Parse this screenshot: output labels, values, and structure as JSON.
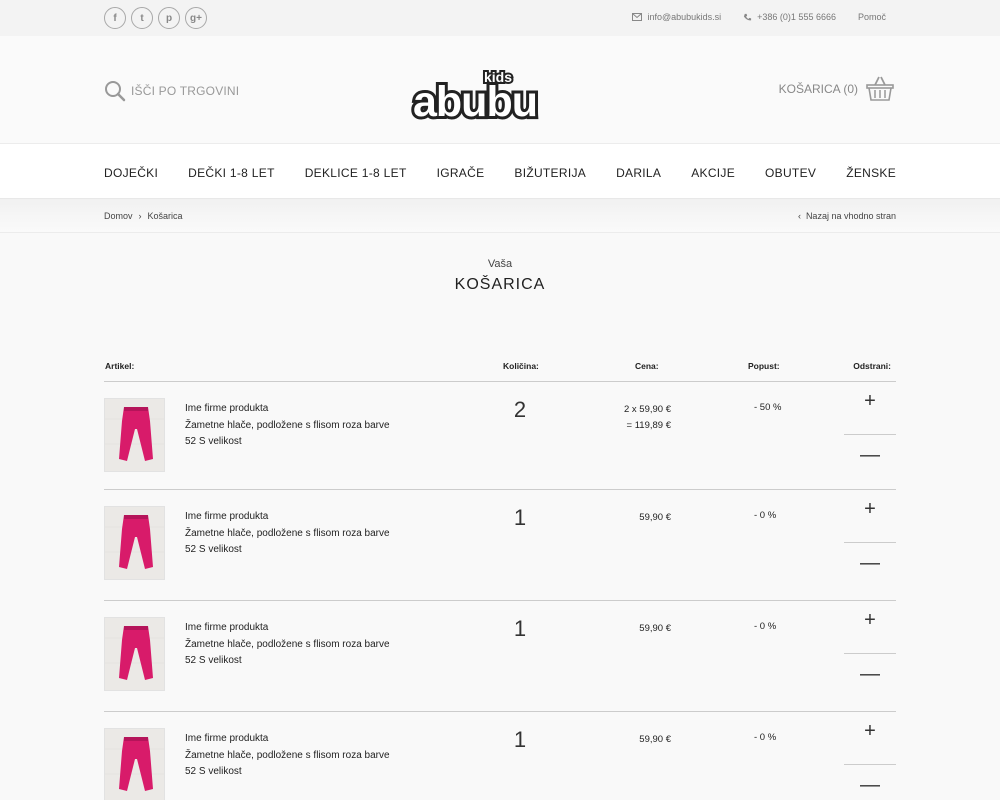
{
  "topbar": {
    "social": [
      {
        "icon": "facebook-icon",
        "glyph": "f"
      },
      {
        "icon": "twitter-icon",
        "glyph": "t"
      },
      {
        "icon": "pinterest-icon",
        "glyph": "p"
      },
      {
        "icon": "google-plus-icon",
        "glyph": "g+"
      }
    ],
    "email": "info@abubukids.si",
    "phone": "+386 (0)1 555 6666",
    "help": "Pomoč"
  },
  "header": {
    "search_label": "IŠČI PO TRGOVINI",
    "logo_kids": "kids",
    "logo_main": "abubu",
    "cart_label": "KOŠARICA (0)"
  },
  "nav": {
    "items": [
      "DOJEČKI",
      "DEČKI 1-8 LET",
      "DEKLICE 1-8 LET",
      "IGRAČE",
      "BIŽUTERIJA",
      "DARILA",
      "AKCIJE",
      "OBUTEV",
      "ŽENSKE"
    ]
  },
  "breadcrumb": {
    "home": "Domov",
    "separator": "›",
    "current": "Košarica",
    "back_arrow": "‹",
    "back": "Nazaj na vhodno stran"
  },
  "heading": {
    "small": "Vaša",
    "title": "KOŠARICA"
  },
  "table": {
    "headers": {
      "article": "Artikel:",
      "quantity": "Količina:",
      "price": "Cena:",
      "discount": "Popust:",
      "remove": "Odstrani:"
    },
    "rows": [
      {
        "brand": "Ime firme produkta",
        "name": "Žametne hlače, podložene s flisom roza barve",
        "size": "52 S velikost",
        "qty": "2",
        "price_line1": "2 x 59,90 €",
        "price_line2": "= 119,89 €",
        "discount": "- 50 %"
      },
      {
        "brand": "Ime firme produkta",
        "name": "Žametne hlače, podložene s flisom roza barve",
        "size": "52 S velikost",
        "qty": "1",
        "price_line1": "59,90 €",
        "price_line2": "",
        "discount": "- 0 %"
      },
      {
        "brand": "Ime firme produkta",
        "name": "Žametne hlače, podložene s flisom roza barve",
        "size": "52 S velikost",
        "qty": "1",
        "price_line1": "59,90 €",
        "price_line2": "",
        "discount": "- 0 %"
      },
      {
        "brand": "Ime firme produkta",
        "name": "Žametne hlače, podložene s flisom roza barve",
        "size": "52 S velikost",
        "qty": "1",
        "price_line1": "59,90 €",
        "price_line2": "",
        "discount": "- 0 %"
      }
    ],
    "plus_glyph": "+",
    "minus_glyph": "—"
  },
  "colors": {
    "product_pink": "#d81b6a",
    "text_dark": "#222222",
    "muted": "#888888"
  }
}
